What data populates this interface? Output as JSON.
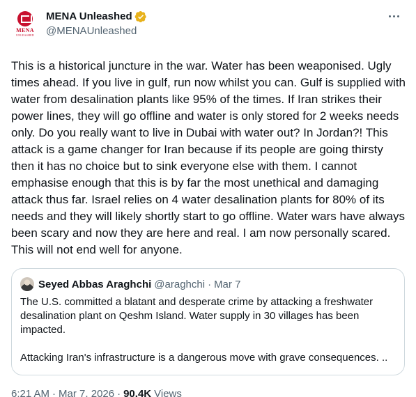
{
  "author": {
    "display_name": "MENA Unleashed",
    "handle": "@MENAUnleashed",
    "avatar_text": "MENA",
    "avatar_subtext": "UNLEASHED",
    "verified_color": "#e8b21c"
  },
  "tweet": {
    "text": "This is a historical juncture in the war. Water has been weaponised. Ugly times ahead. If you live in gulf, run now whilst you can. Gulf is supplied with water from desalination plants like 95% of the times. If Iran strikes their power lines, they will go offline and water is only stored for 2 weeks needs only. Do you really want to live in Dubai with water out? In Jordan?! This attack is a game changer for Iran because if its people are going thirsty then it has no choice but to sink everyone else with them. I cannot emphasise enough that this is by far the most unethical and damaging attack thus far. Israel relies on 4 water desalination plants for 80% of its needs and they will likely shortly start to go offline. Water wars have always been scary and now they are here and real. I am now personally scared. This will not end well for anyone.",
    "time": "6:21 AM",
    "date": "Mar 7, 2026",
    "views_count": "90.4K",
    "views_label": "Views"
  },
  "quote": {
    "display_name": "Seyed Abbas Araghchi",
    "handle": "@araghchi",
    "date": "Mar 7",
    "paragraph_1": "The U.S. committed a blatant and desperate crime by attacking a freshwater desalination plant on Qeshm Island. Water supply in 30 villages has been impacted.",
    "paragraph_2": "Attacking Iran's infrastructure is a dangerous move with grave consequences. .."
  },
  "icons": {
    "more": "more-horizontal-icon",
    "verified": "verified-badge-icon"
  }
}
